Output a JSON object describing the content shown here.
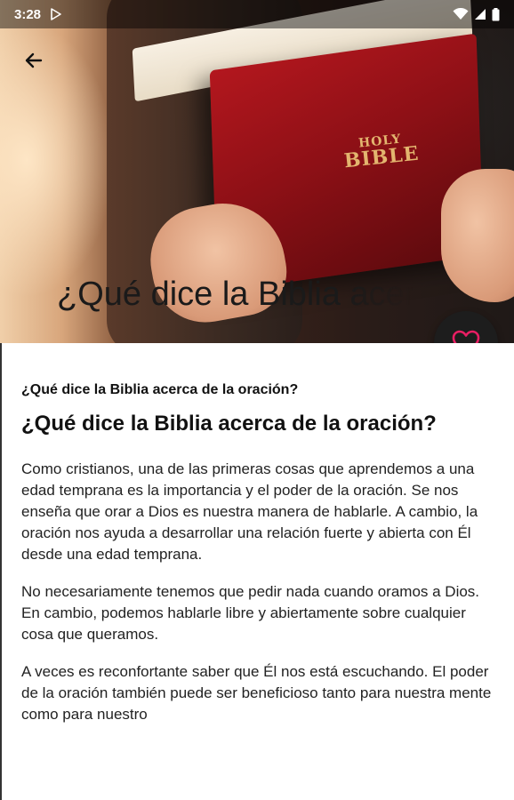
{
  "status_bar": {
    "time": "3:28",
    "icons": [
      "play-store-icon",
      "wifi-icon",
      "signal-icon",
      "battery-icon"
    ]
  },
  "hero": {
    "bible_cover_line1": "HOLY",
    "bible_cover_line2": "BIBLE",
    "title_overlay": "¿Qué dice la Biblia acerca de la oración?"
  },
  "toolbar": {
    "back_icon": "arrow-back-icon"
  },
  "fab": {
    "icon": "heart-outline-icon",
    "color": "#e91e63"
  },
  "article": {
    "subtitle": "¿Qué dice la Biblia acerca de la oración?",
    "heading": "¿Qué dice la Biblia acerca de la oración?",
    "paragraphs": [
      "Como cristianos, una de las primeras cosas que aprendemos a una edad temprana es la importancia y el poder de la oración. Se nos enseña que orar a Dios es nuestra manera de hablarle. A cambio, la oración nos ayuda a desarrollar una relación fuerte y abierta con Él desde una edad temprana.",
      "No necesariamente tenemos que pedir nada cuando oramos a Dios. En cambio, podemos hablarle libre y abiertamente sobre cualquier cosa que queramos.",
      "A veces es reconfortante saber que Él nos está escuchando. El poder de la oración también puede ser beneficioso tanto para nuestra mente como para nuestro"
    ]
  }
}
